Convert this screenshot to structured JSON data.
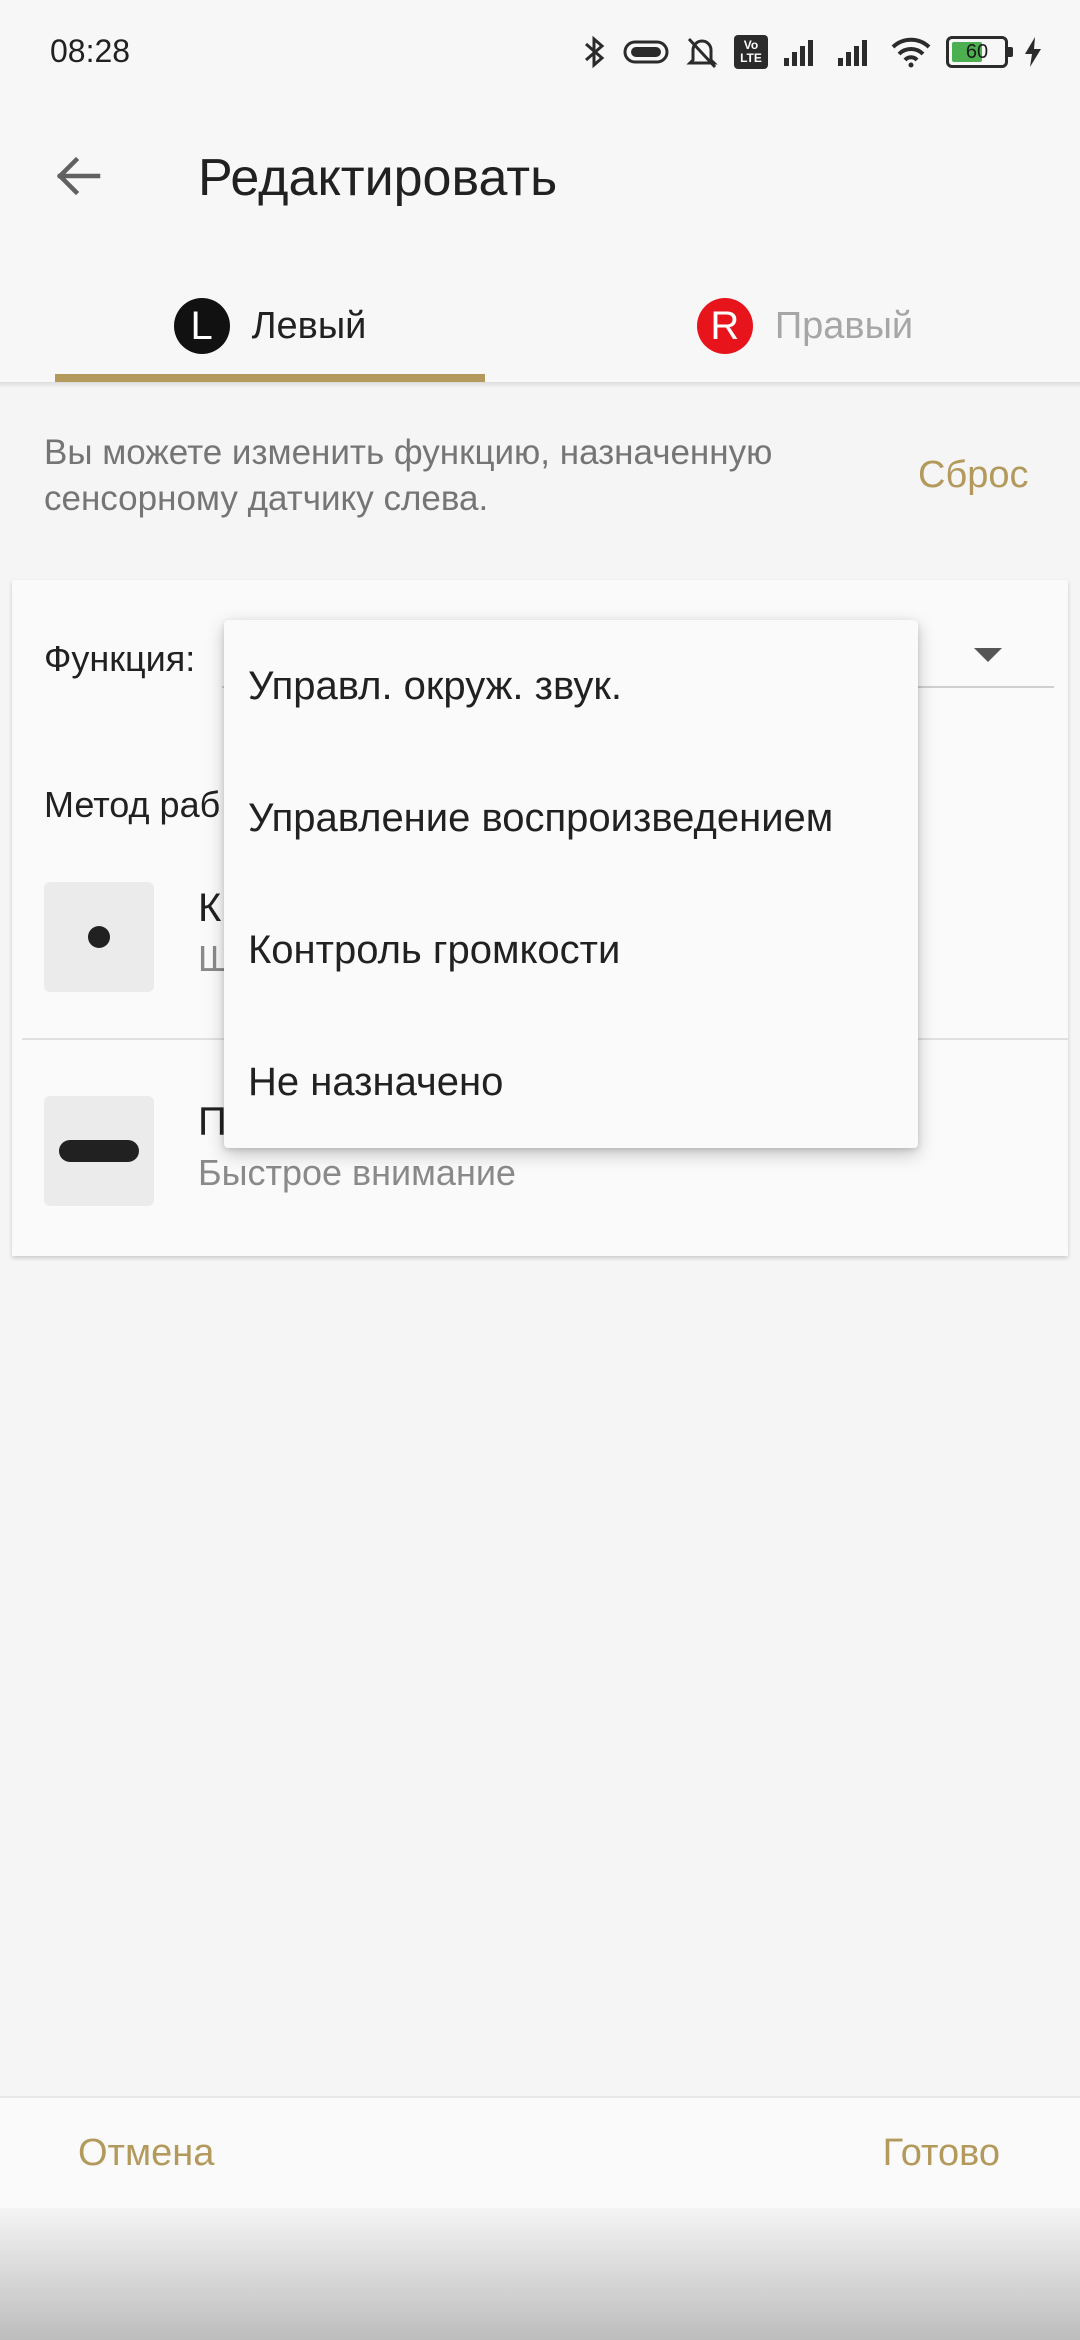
{
  "status_bar": {
    "time": "08:28",
    "icons": [
      "bluetooth-icon",
      "headset-icon",
      "alarm-off-icon",
      "volte-icon",
      "signal-icon",
      "signal-icon",
      "wifi-icon",
      "battery-icon",
      "charging-icon"
    ],
    "volte_top": "Vo",
    "volte_bottom": "LTE",
    "battery_level": "60",
    "battery_fraction": 0.6
  },
  "header": {
    "title": "Редактировать",
    "back_icon": "arrow-left-icon"
  },
  "tabs": [
    {
      "badge": "L",
      "label": "Левый",
      "active": true
    },
    {
      "badge": "R",
      "label": "Правый",
      "active": false
    }
  ],
  "description": {
    "text": "Вы можете изменить функцию, назначенную сенсорному датчику слева.",
    "reset_label": "Сброс"
  },
  "card": {
    "function_label": "Функция:",
    "method_label": "Метод раб",
    "gestures": [
      {
        "icon": "tap-icon",
        "title": "К",
        "subtitle": "Ш"
      },
      {
        "icon": "press-hold-icon",
        "title": "П",
        "subtitle": "Быстрое внимание"
      }
    ]
  },
  "dropdown": {
    "items": [
      "Управл. окруж. звук.",
      "Управление воспроизведением",
      "Контроль громкости",
      "Не назначено"
    ]
  },
  "bottom_bar": {
    "cancel_label": "Отмена",
    "done_label": "Готово"
  },
  "colors": {
    "accent": "#b39a5c",
    "right_badge": "#e8141c",
    "left_badge": "#111111"
  }
}
